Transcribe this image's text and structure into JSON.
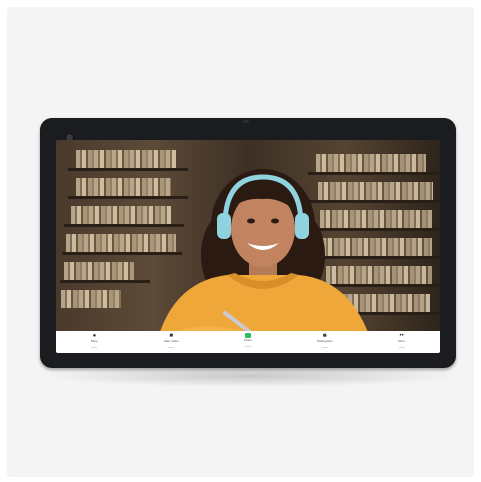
{
  "toolbar": {
    "items": [
      {
        "label": "Mute",
        "icon": "microphone-icon"
      },
      {
        "label": "Start Video",
        "icon": "video-camera-icon"
      },
      {
        "label": "Share",
        "icon": "share-screen-icon",
        "color": "#2fbf5a"
      },
      {
        "label": "Participants",
        "icon": "participants-icon"
      },
      {
        "label": "More",
        "icon": "more-icon"
      }
    ]
  },
  "colors": {
    "bezel": "#1b1c1f",
    "toolbar": "#ffffff",
    "share_accent": "#2fbf5a",
    "hoodie": "#f0a73a",
    "headphones": "#8ed3df"
  }
}
